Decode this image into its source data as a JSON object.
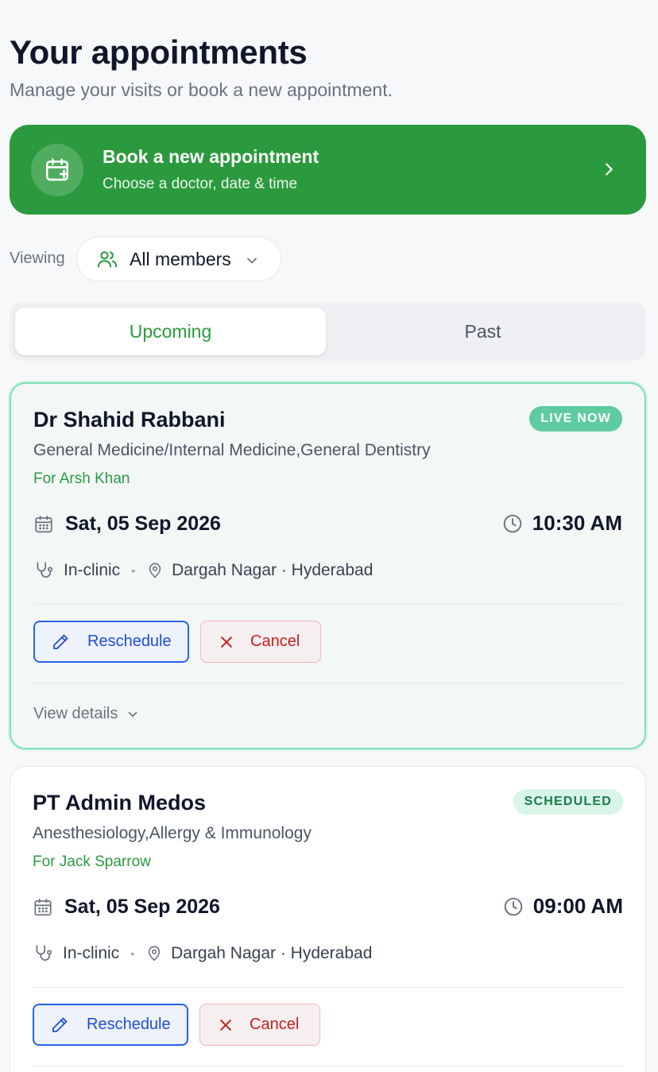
{
  "header": {
    "title": "Your appointments",
    "subtitle": "Manage your visits or book a new appointment."
  },
  "book_banner": {
    "title": "Book a new appointment",
    "subtitle": "Choose a doctor, date & time",
    "icon": "calendar-plus-icon",
    "color": "#2b9a3e"
  },
  "filter": {
    "label": "Viewing",
    "selected": "All members"
  },
  "tabs": [
    {
      "label": "Upcoming",
      "active": true
    },
    {
      "label": "Past",
      "active": false
    }
  ],
  "appointments": [
    {
      "doctor": "Dr Shahid Rabbani",
      "status": "LIVE NOW",
      "specialty": "General Medicine/Internal Medicine,General Dentistry",
      "patient": "For Arsh Khan",
      "date": "Sat, 05 Sep 2026",
      "time": "10:30 AM",
      "mode": "In-clinic",
      "location": "Dargah Nagar · Hyderabad",
      "reschedule_label": "Reschedule",
      "cancel_label": "Cancel",
      "details_label": "View details"
    },
    {
      "doctor": "PT Admin Medos",
      "status": "SCHEDULED",
      "specialty": "Anesthesiology,Allergy & Immunology",
      "patient": "For Jack Sparrow",
      "date": "Sat, 05 Sep 2026",
      "time": "09:00 AM",
      "mode": "In-clinic",
      "location": "Dargah Nagar · Hyderabad",
      "reschedule_label": "Reschedule",
      "cancel_label": "Cancel"
    }
  ],
  "colors": {
    "brand_green": "#2b9a3e",
    "live_badge": "#5ecba1",
    "reschedule_blue": "#2563eb",
    "cancel_red": "#c81e1e"
  }
}
